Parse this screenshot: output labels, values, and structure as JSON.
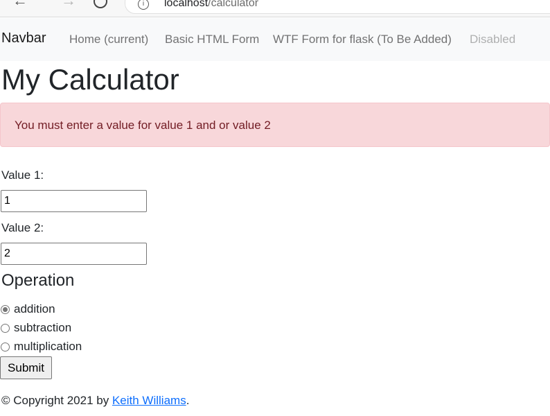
{
  "browser": {
    "back_icon": "arrow-left-icon",
    "forward_icon": "arrow-right-icon",
    "reload_icon": "reload-icon",
    "info_icon": "info-icon",
    "url_host": "localhost",
    "url_path": "/calculator"
  },
  "navbar": {
    "brand": "Navbar",
    "links": [
      {
        "label": "Home (current)"
      },
      {
        "label": "Basic HTML Form"
      },
      {
        "label": "WTF Form for flask (To Be Added)"
      },
      {
        "label": "Disabled"
      }
    ]
  },
  "page": {
    "title": "My Calculator",
    "alert": "You must enter a value for value 1 and or value 2",
    "alert_colors": {
      "background": "#f8d7da",
      "border": "#f5c6cb",
      "text": "#721c24"
    }
  },
  "form": {
    "value1_label": "Value 1:",
    "value1": "1",
    "value2_label": "Value 2:",
    "value2": "2",
    "operation_heading": "Operation",
    "operations": [
      {
        "label": "addition",
        "checked": true
      },
      {
        "label": "subtraction",
        "checked": false
      },
      {
        "label": "multiplication",
        "checked": false
      }
    ],
    "submit_label": "Submit"
  },
  "footer": {
    "prefix": "© Copyright 2021 by ",
    "author_link": "Keith Williams",
    "suffix": "."
  }
}
